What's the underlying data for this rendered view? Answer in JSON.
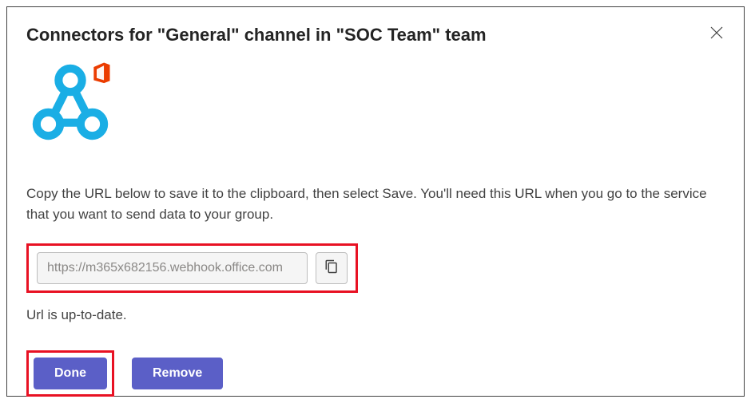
{
  "dialog": {
    "title": "Connectors for \"General\" channel in \"SOC Team\" team",
    "instruction": "Copy the URL below to save it to the clipboard, then select Save. You'll need this URL when you go to the service that you want to send data to your group.",
    "url_value": "https://m365x682156.webhook.office.com",
    "status": "Url is up-to-date.",
    "done_label": "Done",
    "remove_label": "Remove"
  },
  "icons": {
    "close": "close-icon",
    "copy": "copy-icon",
    "webhook": "webhook-logo"
  },
  "colors": {
    "primary": "#5b5fc7",
    "highlight": "#e81123",
    "webhook_blue": "#1aaee5",
    "office_orange": "#eb3c00"
  }
}
